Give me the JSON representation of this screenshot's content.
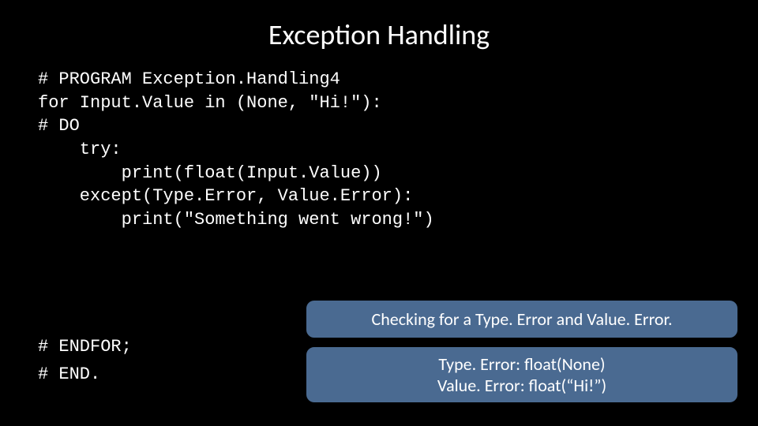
{
  "title": "Exception Handling",
  "code": {
    "line1": "# PROGRAM Exception.Handling4",
    "line2": "for Input.Value in (None, \"Hi!\"):",
    "line3": "# DO",
    "line4": "    try:",
    "line5": "        print(float(Input.Value))",
    "line6": "    except(Type.Error, Value.Error):",
    "line7": "        print(\"Something went wrong!\")"
  },
  "endblock": {
    "line1": "# ENDFOR;",
    "line2": "# END."
  },
  "callout1": "Checking for a Type. Error and Value. Error.",
  "callout2": {
    "line1": "Type. Error: float(None)",
    "line2": "Value. Error: float(“Hi!”)"
  }
}
